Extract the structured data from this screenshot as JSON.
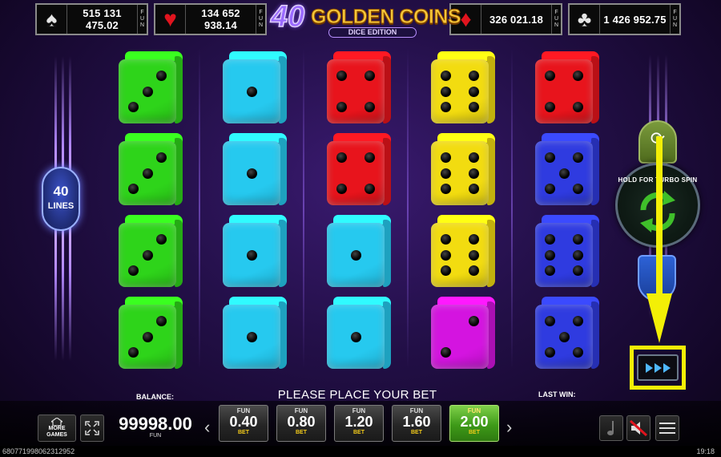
{
  "jackpots": [
    {
      "suit": "spades",
      "glyph": "♠",
      "value": "515 131 475.02",
      "fun": "FUN"
    },
    {
      "suit": "hearts",
      "glyph": "♥",
      "value": "134 652 938.14",
      "fun": "FUN"
    },
    {
      "suit": "diamonds",
      "glyph": "♦",
      "value": "326 021.18",
      "fun": "FUN"
    },
    {
      "suit": "clubs",
      "glyph": "♣",
      "value": "1 426 952.75",
      "fun": "FUN"
    }
  ],
  "logo": {
    "number": "40",
    "title": "GOLDEN COINS",
    "edition": "DICE EDITION"
  },
  "lines": {
    "count": "40",
    "label": "LINES"
  },
  "reels": [
    {
      "color": "#2ed41a",
      "values": [
        3,
        3,
        3,
        3
      ]
    },
    {
      "color": "#26c9ef",
      "values": [
        1,
        1,
        1,
        1
      ]
    },
    {
      "color": "#e8141c",
      "values": [
        4,
        4,
        1,
        1
      ]
    },
    {
      "color": "#f2dc10",
      "values": [
        6,
        6,
        6,
        2
      ]
    },
    {
      "color": "#d414e0",
      "values": [],
      "note": ""
    }
  ],
  "reel_faces": [
    [
      {
        "color": "#2ed41a",
        "value": 3
      },
      {
        "color": "#2ed41a",
        "value": 3
      },
      {
        "color": "#2ed41a",
        "value": 3
      },
      {
        "color": "#2ed41a",
        "value": 3
      }
    ],
    [
      {
        "color": "#26c9ef",
        "value": 1
      },
      {
        "color": "#26c9ef",
        "value": 1
      },
      {
        "color": "#26c9ef",
        "value": 1
      },
      {
        "color": "#26c9ef",
        "value": 1
      }
    ],
    [
      {
        "color": "#e8141c",
        "value": 4
      },
      {
        "color": "#e8141c",
        "value": 4
      },
      {
        "color": "#26c9ef",
        "value": 1
      },
      {
        "color": "#26c9ef",
        "value": 1
      }
    ],
    [
      {
        "color": "#f2dc10",
        "value": 6
      },
      {
        "color": "#f2dc10",
        "value": 6
      },
      {
        "color": "#f2dc10",
        "value": 6
      },
      {
        "color": "#d414e0",
        "value": 2
      }
    ],
    [
      {
        "color": "#e8141c",
        "value": 4
      },
      {
        "color": "#2f3be0",
        "value": 5
      },
      {
        "color": "#2f3be0",
        "value": 6
      },
      {
        "color": "#2f3be0",
        "value": 5
      }
    ]
  ],
  "controls": {
    "hold_text": "HOLD FOR TURBO SPIN",
    "autoplay_icon": "autoplay-icon",
    "spin_icon": "spin-arrows-icon",
    "fast_forward_icon": "fast-forward-icon"
  },
  "message": "PLEASE PLACE YOUR BET",
  "balance": {
    "label": "BALANCE:",
    "value": "99998.00",
    "currency": "FUN"
  },
  "last_win": {
    "label": "LAST WIN:"
  },
  "more_games": {
    "line1": "MORE",
    "line2": "GAMES"
  },
  "bets": [
    {
      "top": "FUN",
      "value": "0.40",
      "bottom": "BET",
      "selected": false
    },
    {
      "top": "FUN",
      "value": "0.80",
      "bottom": "BET",
      "selected": false
    },
    {
      "top": "FUN",
      "value": "1.20",
      "bottom": "BET",
      "selected": false
    },
    {
      "top": "FUN",
      "value": "1.60",
      "bottom": "BET",
      "selected": false
    },
    {
      "top": "FUN",
      "value": "2.00",
      "bottom": "BET",
      "selected": true
    }
  ],
  "chevrons": {
    "left": "‹",
    "right": "›"
  },
  "status": {
    "id": "680771998062312952",
    "time": "19:18"
  },
  "colors": {
    "highlight": "#f3ef06",
    "accent_purple": "#b58aff",
    "bet_selected": "#3e9a18"
  }
}
